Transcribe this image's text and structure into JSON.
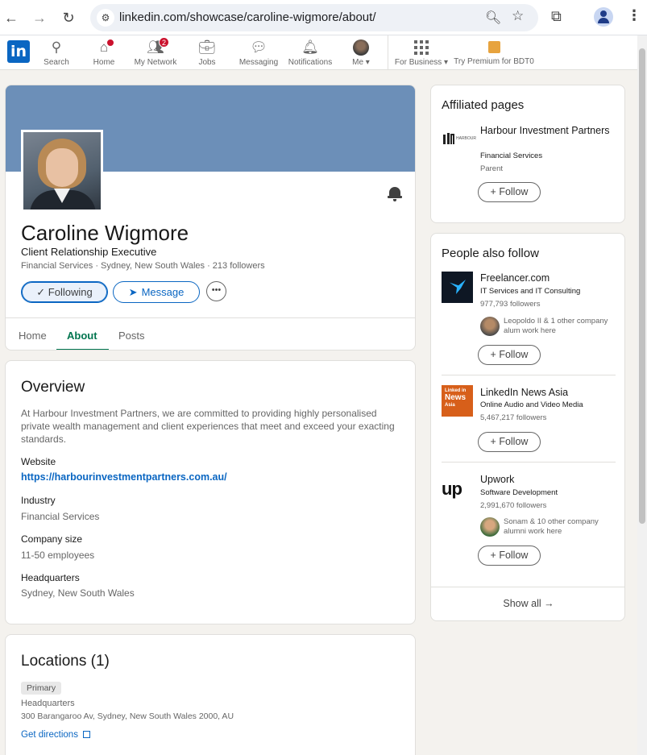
{
  "browser": {
    "url": "linkedin.com/showcase/caroline-wigmore/about/"
  },
  "nav": {
    "items": [
      {
        "label": "Search"
      },
      {
        "label": "Home"
      },
      {
        "label": "My Network",
        "badge": "2"
      },
      {
        "label": "Jobs"
      },
      {
        "label": "Messaging"
      },
      {
        "label": "Notifications"
      },
      {
        "label": "Me ▾"
      },
      {
        "label": "For Business ▾"
      },
      {
        "label": "Try Premium for BDT0"
      }
    ]
  },
  "profile": {
    "name": "Caroline Wigmore",
    "headline": "Client Relationship Executive",
    "meta": "Financial Services · Sydney, New South Wales · 213 followers",
    "following_label": "✓ Following",
    "message_label": "Message",
    "more_label": "•••",
    "tabs": [
      "Home",
      "About",
      "Posts"
    ]
  },
  "overview": {
    "title": "Overview",
    "description": "At Harbour Investment Partners, we are committed to providing highly personalised private wealth management and client experiences that meet and exceed your exacting standards.",
    "website_label": "Website",
    "website": "https://harbourinvestmentpartners.com.au/",
    "industry_label": "Industry",
    "industry": "Financial Services",
    "size_label": "Company size",
    "size": "11-50 employees",
    "hq_label": "Headquarters",
    "hq": "Sydney, New South Wales"
  },
  "locations": {
    "title": "Locations (1)",
    "primary": "Primary",
    "hq_label": "Headquarters",
    "address": "300 Barangaroo Av, Sydney, New South Wales 2000, AU",
    "directions": "Get directions"
  },
  "affiliated": {
    "title": "Affiliated pages",
    "name": "Harbour Investment Partners",
    "industry": "Financial Services",
    "relation": "Parent",
    "follow": "+ Follow"
  },
  "people_also_follow": {
    "title": "People also follow",
    "items": [
      {
        "name": "Freelancer.com",
        "industry": "IT Services and IT Consulting",
        "followers": "977,793 followers",
        "connections": "Leopoldo II & 1 other company alum work here",
        "follow": "+ Follow"
      },
      {
        "name": "LinkedIn News Asia",
        "industry": "Online Audio and Video Media",
        "followers": "5,467,217 followers",
        "follow": "+ Follow",
        "logo_lines": [
          "Linked in",
          "News",
          "Asia"
        ]
      },
      {
        "name": "Upwork",
        "industry": "Software Development",
        "followers": "2,991,670 followers",
        "connections": "Sonam & 10 other company alumni work here",
        "follow": "+ Follow",
        "logo_text": "up"
      }
    ],
    "show_all": "Show all →"
  }
}
